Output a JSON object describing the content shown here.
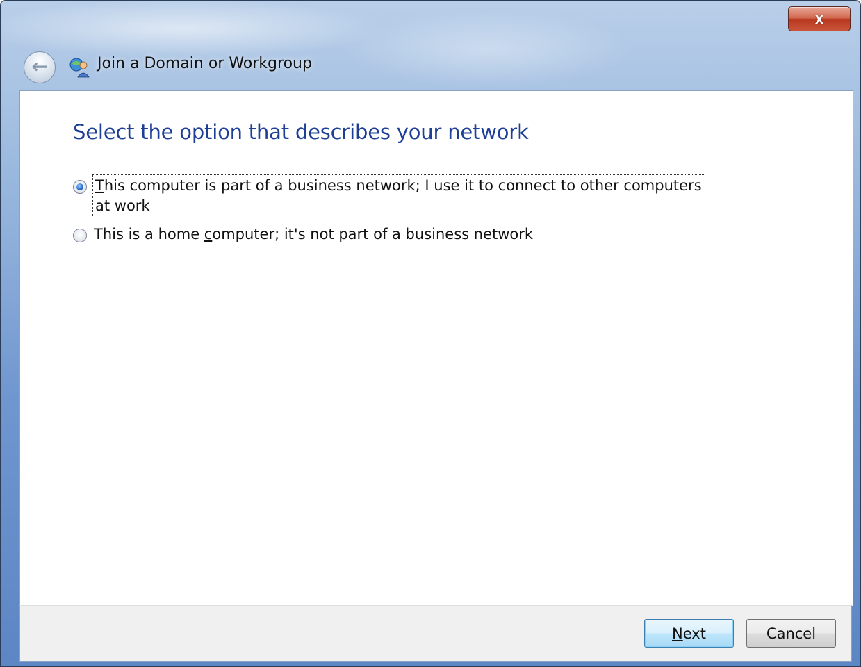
{
  "window": {
    "title": "Join a Domain or Workgroup",
    "close_label": "x"
  },
  "content": {
    "heading": "Select the option that describes your network",
    "options": [
      {
        "access_key": "T",
        "label_rest": "his computer is part of a business network; I use it to connect to other computers at work",
        "selected": true
      },
      {
        "label_before": "This is a home ",
        "access_key": "c",
        "label_after": "omputer; it's not part of a business network",
        "selected": false
      }
    ]
  },
  "footer": {
    "next_key": "N",
    "next_rest": "ext",
    "cancel_label": "Cancel"
  },
  "colors": {
    "heading": "#1e3f96",
    "primary_button_border": "#3c7fb1"
  },
  "icons": {
    "back": "back-arrow-icon",
    "app": "network-users-icon",
    "close": "close-icon"
  }
}
